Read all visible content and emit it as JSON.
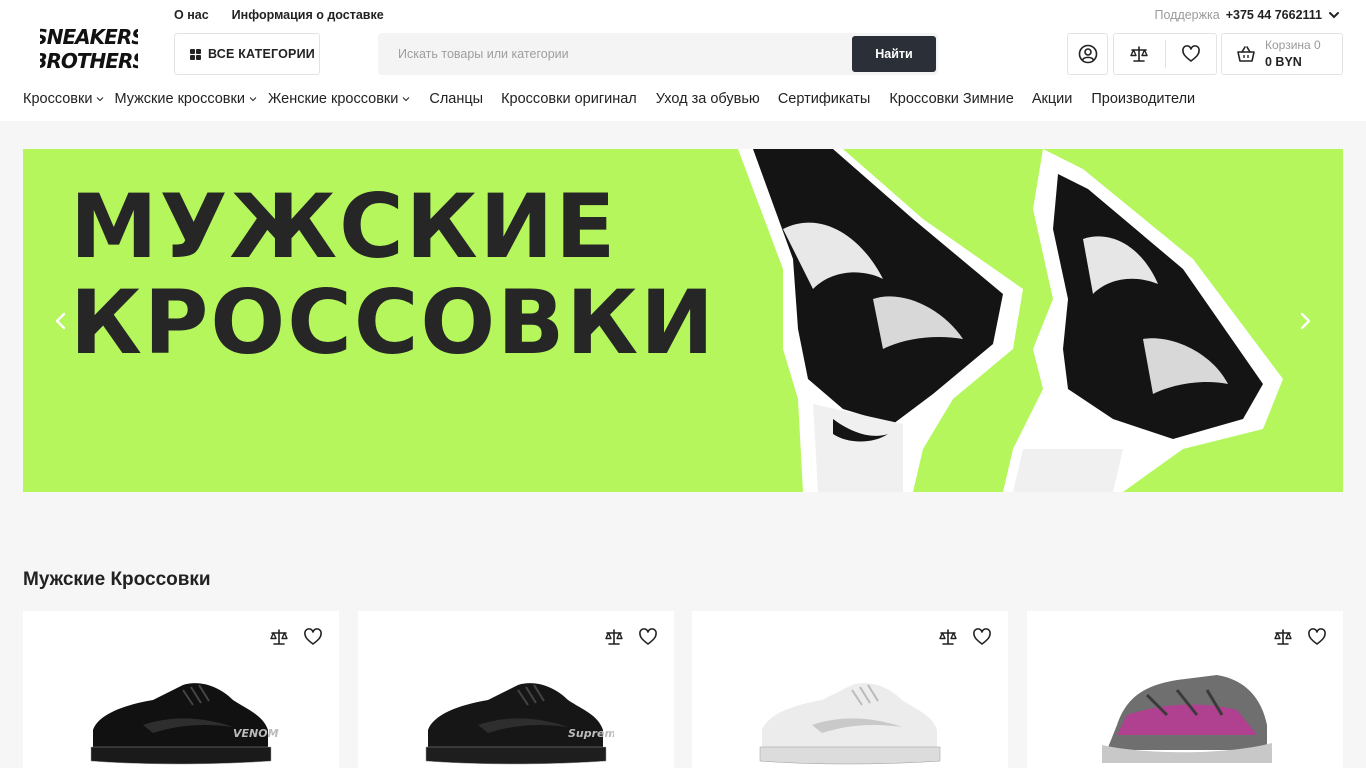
{
  "logo": {
    "line1": "SNEAKERS",
    "line2": "BROTHERS"
  },
  "top_links": [
    "О нас",
    "Информация о доставке"
  ],
  "support": {
    "label": "Поддержка",
    "phone": "+375 44 7662111"
  },
  "all_categories_label": "ВСЕ КАТЕГОРИИ",
  "search": {
    "placeholder": "Искать товары или категории",
    "button": "Найти"
  },
  "cart": {
    "label": "Корзина 0",
    "total": "0 BYN"
  },
  "nav": [
    {
      "label": "Кроссовки",
      "dropdown": true
    },
    {
      "label": "Мужские кроссовки",
      "dropdown": true
    },
    {
      "label": "Женские кроссовки",
      "dropdown": true
    },
    {
      "label": "Сланцы",
      "dropdown": false
    },
    {
      "label": "Кроссовки оригинал",
      "dropdown": false
    },
    {
      "label": "Уход за обувью",
      "dropdown": false
    },
    {
      "label": "Сертификаты",
      "dropdown": false
    },
    {
      "label": "Кроссовки Зимние",
      "dropdown": false
    },
    {
      "label": "Акции",
      "dropdown": false
    },
    {
      "label": "Производители",
      "dropdown": false
    }
  ],
  "banner": {
    "line1": "МУЖСКИЕ",
    "line2": "КРОССОВКИ",
    "bg_color": "#b4f65c"
  },
  "section_title": "Мужские Кроссовки",
  "products": [
    {
      "image": "black-low-sneaker-venom",
      "shoe_color": "#111111",
      "sole_color": "#1a1a1a",
      "logo_text": "VENOM"
    },
    {
      "image": "black-low-sneaker-supreme",
      "shoe_color": "#161616",
      "sole_color": "#1e1e1e",
      "logo_text": "Supreme"
    },
    {
      "image": "white-low-sneaker",
      "shoe_color": "#ececec",
      "sole_color": "#dcdcdc",
      "logo_text": ""
    },
    {
      "image": "grey-pink-chunky-sneaker",
      "shoe_color": "#6f6f6f",
      "sole_color": "#c8c8c8",
      "logo_text": ""
    }
  ],
  "colors": {
    "accent_dark": "#2b3038",
    "page_bg": "#f6f6f6"
  }
}
